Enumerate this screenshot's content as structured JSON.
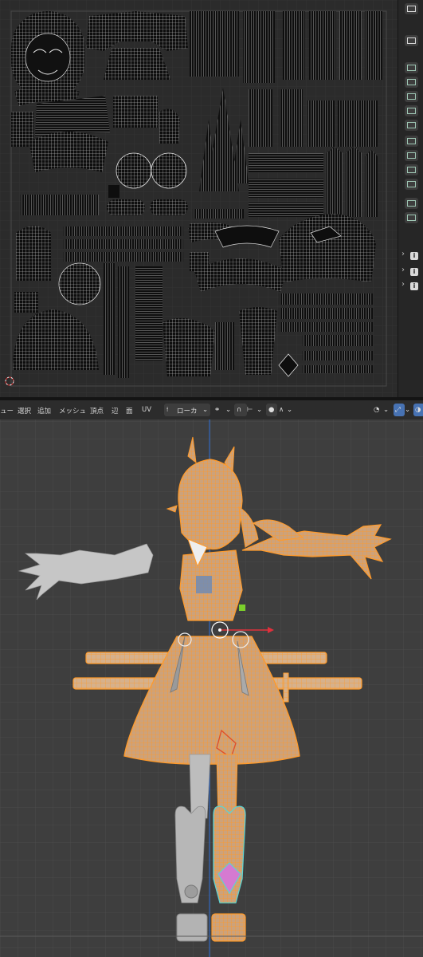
{
  "editor_header": {
    "menus": [
      "ュー",
      "選択",
      "追加",
      "メッシュ",
      "頂点",
      "辺",
      "面",
      "UV"
    ],
    "orientation_label": "ローカ",
    "colors": {
      "header_bg": "#2c2c2c",
      "viewport_bg": "#3e3e3e",
      "uv_bg": "#2b2b2b",
      "mesh_orange": "#ff9c2a",
      "active_cyan": "#5fd3d0"
    }
  },
  "uv_editor": {
    "tools": [
      "select-box-icon",
      "cursor-icon",
      "move-icon",
      "rotate-icon",
      "scale-icon",
      "transform-icon",
      "annotate-icon",
      "rip-icon",
      "grab-icon",
      "relax-icon",
      "pinch-icon",
      "sample-icon",
      "clipboard-icon"
    ],
    "side_panels": [
      "i",
      "i",
      "i"
    ]
  },
  "viewport": {
    "gizmo_colors": {
      "x_axis": "#e0303c",
      "y_axis": "#7bcf2b",
      "z_axis": "#2f6fd8"
    }
  }
}
